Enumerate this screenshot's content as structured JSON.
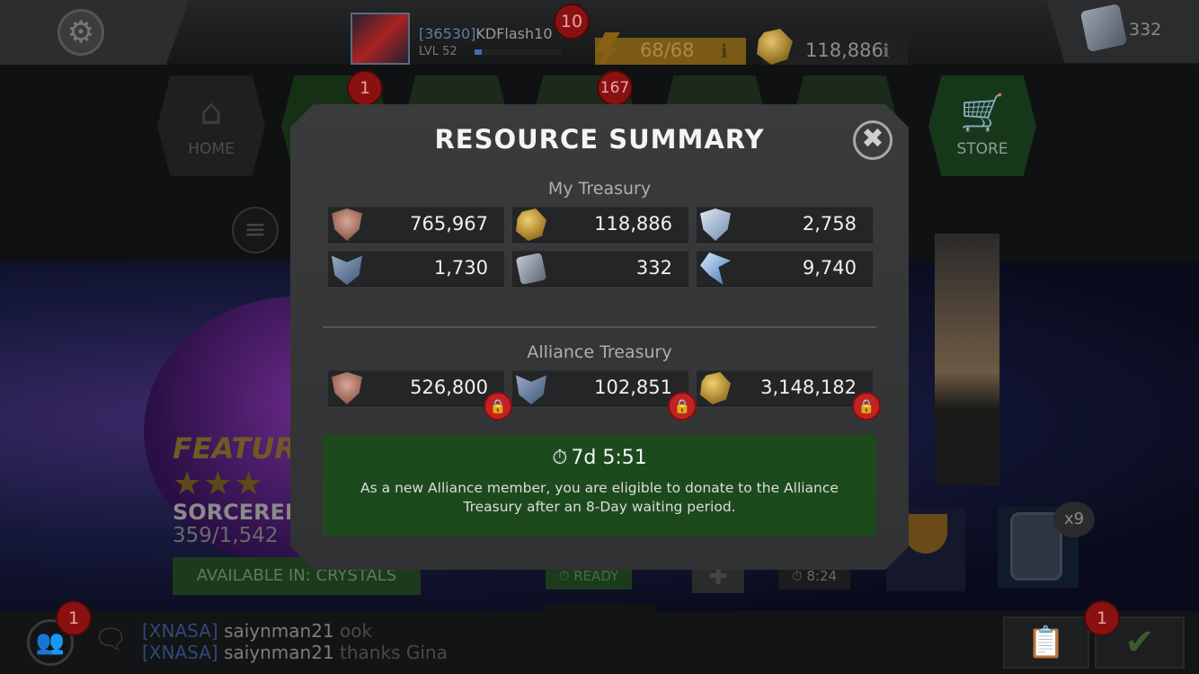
{
  "topbar": {
    "profile_id": "[36530]",
    "profile_name": "KDFlash10",
    "profile_level": "LVL 52",
    "xp_fraction": 0.08,
    "notification_badge": "10",
    "energy": "68/68",
    "gold": "118,886",
    "info_glyph": "ℹ",
    "units": "332",
    "icons": {
      "settings": "gear-icon",
      "energy": "lightning-icon",
      "gold": "gold-nugget-icon",
      "units": "unit-icon"
    }
  },
  "nav": {
    "home_label": "HOME",
    "store_label": "STORE",
    "badge_2": "1",
    "badge_4": "167",
    "menu_glyph": "≡"
  },
  "featured": {
    "heading": "FEATURE",
    "stars": "★★★",
    "name": "SORCERER",
    "progress": "359/1,542",
    "available_label": "AVAILABLE IN: CRYSTALS",
    "ready_label": "READY",
    "timer_label": "8:24",
    "crate_count": "x9"
  },
  "chat": {
    "badge": "1",
    "lines": [
      {
        "tag": "[XNASA]",
        "user": "saiynman21",
        "msg": "ook"
      },
      {
        "tag": "[XNASA]",
        "user": "saiynman21",
        "msg": "thanks Gina"
      }
    ],
    "quest_badge": "1"
  },
  "modal": {
    "title": "RESOURCE SUMMARY",
    "close_glyph": "✖",
    "my_treasury_label": "My Treasury",
    "my_treasury": [
      {
        "icon": "shield-shard-icon",
        "value": "765,967"
      },
      {
        "icon": "gold-nugget-icon",
        "value": "118,886"
      },
      {
        "icon": "battlechip-shield-icon",
        "value": "2,758"
      },
      {
        "icon": "loyalty-icon",
        "value": "1,730"
      },
      {
        "icon": "unit-icon",
        "value": "332"
      },
      {
        "icon": "crystal-shard-icon",
        "value": "9,740"
      }
    ],
    "alliance_treasury_label": "Alliance Treasury",
    "alliance_treasury": [
      {
        "icon": "shield-shard-icon",
        "value": "526,800"
      },
      {
        "icon": "loyalty-icon",
        "value": "102,851"
      },
      {
        "icon": "gold-nugget-icon",
        "value": "3,148,182"
      }
    ],
    "lock_glyph": "🔒",
    "notice": {
      "timer": "7d 5:51",
      "text": "As a new Alliance member, you are eligible to donate to the Alliance Treasury after an 8-Day waiting period."
    }
  }
}
